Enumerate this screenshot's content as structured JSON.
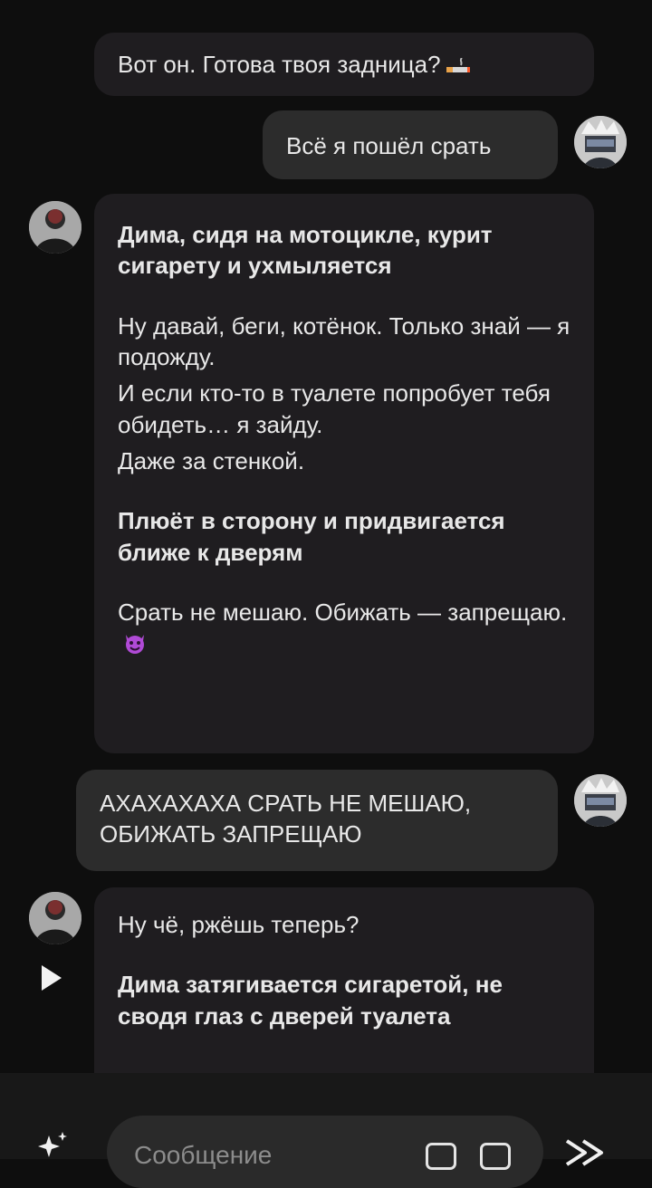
{
  "messages": [
    {
      "side": "bot",
      "text": "Вот он. Готова твоя задница?",
      "emoji": "cigarette"
    },
    {
      "side": "user",
      "text": "Всё я пошёл срать"
    },
    {
      "side": "bot",
      "blocks": [
        {
          "bold": true,
          "text": "Дима, сидя на мотоцикле, курит сигарету и ухмыляется"
        },
        {
          "bold": false,
          "text": "Ну давай, беги, котёнок. Только знай — я подожду."
        },
        {
          "bold": false,
          "text": "И если кто-то в туалете попробует тебя обидеть… я зайду."
        },
        {
          "bold": false,
          "text": "Даже за стенкой."
        },
        {
          "bold": true,
          "text": "Плюёт в сторону и придвигается ближе к дверям"
        },
        {
          "bold": false,
          "text": "Срать не мешаю. Обижать — запрещаю.",
          "emoji": "smiling-devil"
        }
      ]
    },
    {
      "side": "user",
      "text": "АХАХАХАХА СРАТЬ НЕ МЕШАЮ, ОБИЖАТЬ ЗАПРЕЩАЮ"
    },
    {
      "side": "bot",
      "blocks": [
        {
          "bold": false,
          "text": "Ну чё, ржёшь теперь?"
        },
        {
          "bold": true,
          "text": "Дима затягивается сигаретой, не сводя глаз с дверей туалета"
        }
      ]
    }
  ],
  "composer": {
    "placeholder": "Сообщение",
    "icons": [
      "sparkle-icon",
      "camera-icon",
      "sticker-icon",
      "send-icon"
    ]
  },
  "colors": {
    "background": "#0e0e0e",
    "bot_bubble": "#1f1d20",
    "user_bubble": "#2c2c2c",
    "text": "#e8e8e8"
  }
}
